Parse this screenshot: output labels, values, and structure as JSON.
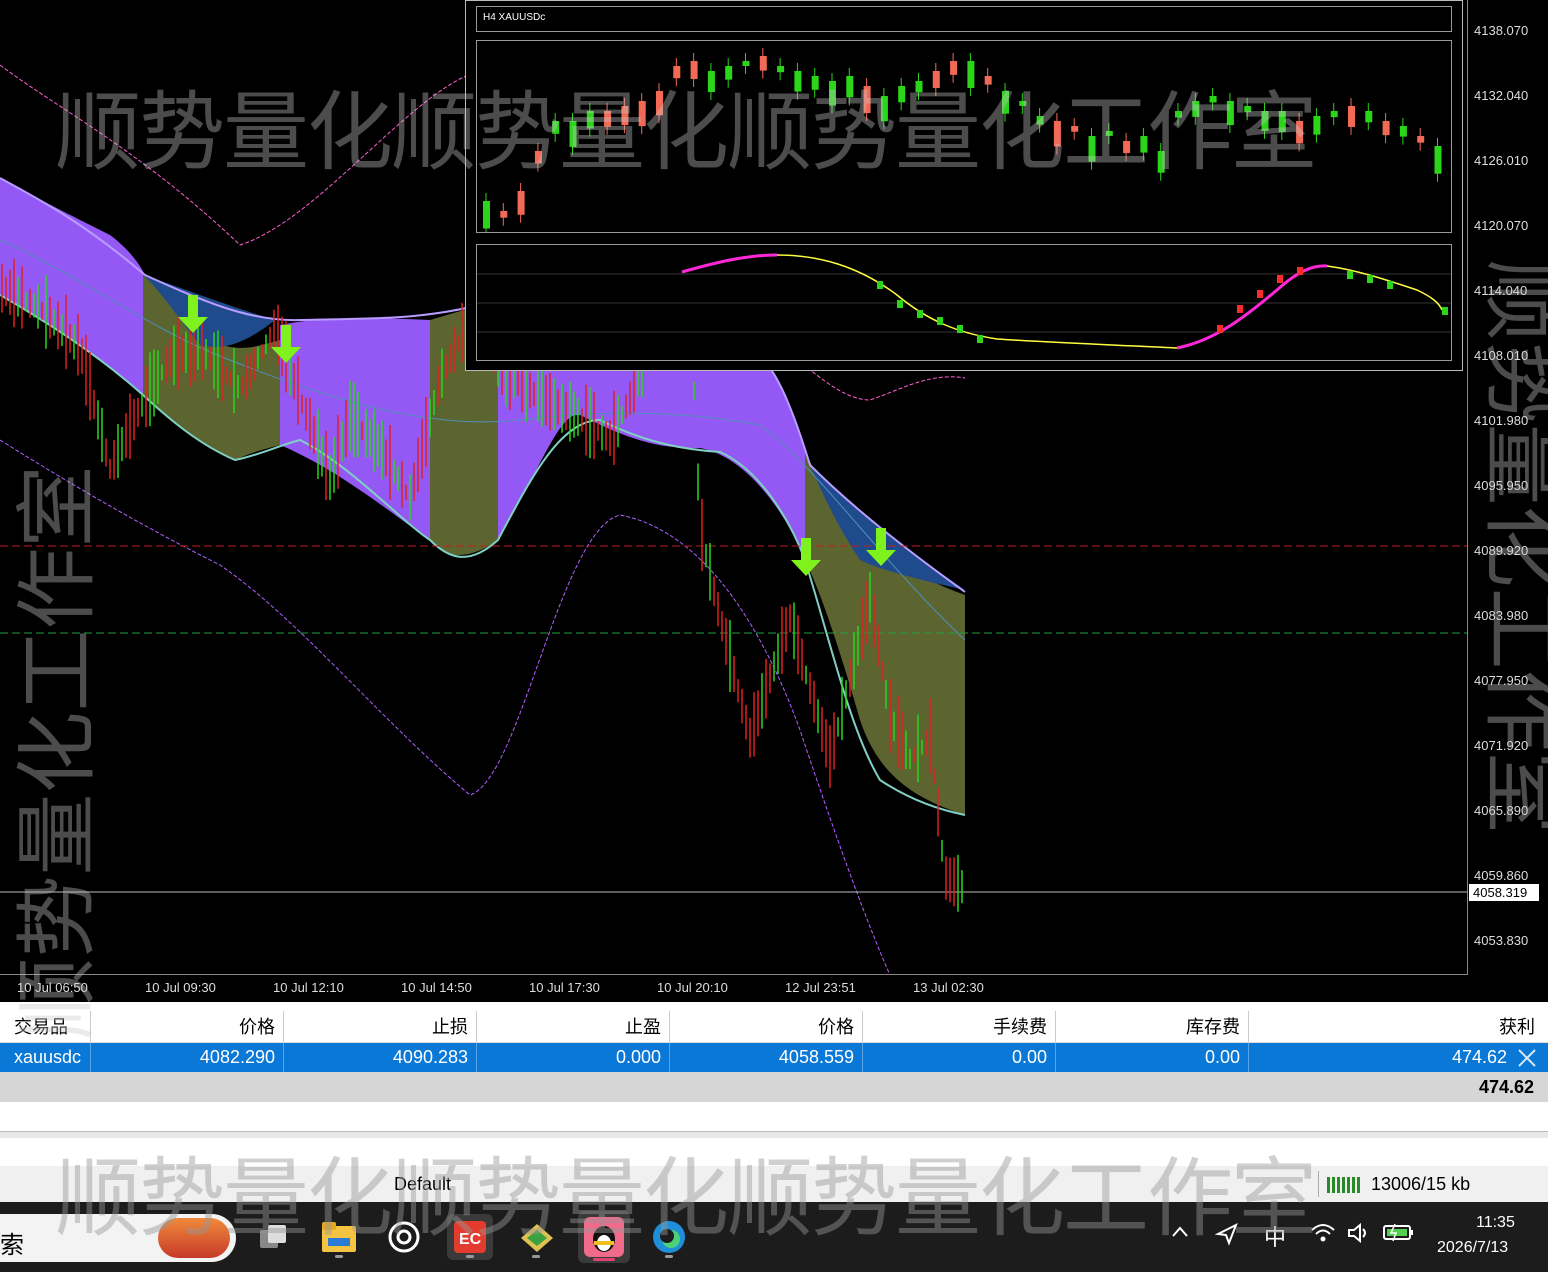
{
  "chart": {
    "symbol_title": "H4  XAUUSDc",
    "price_ticks": [
      "4138.070",
      "4132.040",
      "4126.010",
      "4120.070",
      "4114.040",
      "4108.010",
      "4101.980",
      "4095.950",
      "4089.920",
      "4083.980",
      "4077.950",
      "4071.920",
      "4065.890",
      "4059.860",
      "4053.830"
    ],
    "current_price": "4058.319",
    "time_ticks": [
      "10 Jul 06:50",
      "10 Jul 09:30",
      "10 Jul 12:10",
      "10 Jul 14:50",
      "10 Jul 17:30",
      "10 Jul 20:10",
      "12 Jul 23:51",
      "13 Jul 02:30"
    ],
    "levels": {
      "upper_band": "4105.281",
      "cloud_top": "4085.723",
      "cloud_bottom": "4065.490"
    },
    "colors": {
      "level_upper": "#ff3fb4",
      "level_cloud_top": "#9fe8ff",
      "level_cloud_bottom": "#33c8ee",
      "purple_cloud": "#9459f5",
      "olive_cloud": "#5c6430",
      "blue_cloud": "#1f4a8c",
      "arrow": "#7ff21e",
      "bull_candle": "#2bd51a",
      "bear_candle": "#e02020"
    }
  },
  "watermark": {
    "text_top": "顺势量化顺势量化顺势量化工作室",
    "text_bottom": "顺势量化顺势量化顺势量化工作室",
    "text_left": "顺势量化工作室",
    "text_right": "顺势量化工作室"
  },
  "positions": {
    "headers": [
      "交易品种",
      "价格",
      "止损",
      "止盈",
      "价格",
      "手续费",
      "库存费",
      "获利"
    ],
    "row": [
      "xauusdc",
      "4082.290",
      "4090.283",
      "0.000",
      "4058.559",
      "0.00",
      "0.00",
      "474.62"
    ],
    "total": "474.62"
  },
  "statusbar": {
    "profile": "Default",
    "traffic": "13006/15 kb"
  },
  "taskbar": {
    "search_text": "索",
    "ime": "中",
    "time": "11:35",
    "date": "2026/7/13",
    "apps": [
      "weather-widget-icon",
      "task-view-icon",
      "file-explorer-icon",
      "chatgpt-icon",
      "ec-app-icon",
      "sticky-app-icon",
      "qq-icon",
      "edge-icon"
    ]
  }
}
